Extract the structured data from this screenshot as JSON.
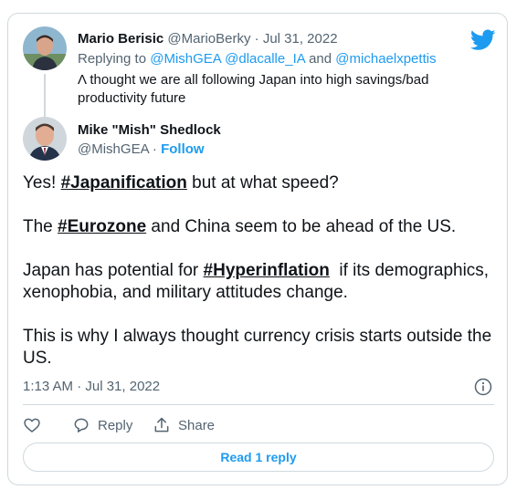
{
  "parent_tweet": {
    "name": "Mario Berisic",
    "handle": "@MarioBerky",
    "separator": "·",
    "date": "Jul 31, 2022",
    "replying_prefix": "Replying to",
    "mentions": [
      "@MishGEA",
      "@dlacalle_IA",
      "@michaelxpettis"
    ],
    "mention_joiner": "and",
    "text": "Λ thought we are all following Japan into high savings/bad productivity future"
  },
  "main_tweet": {
    "name": "Mike \"Mish\" Shedlock",
    "handle": "@MishGEA",
    "separator": "·",
    "follow_label": "Follow",
    "paragraphs": {
      "p1_before": "Yes! ",
      "p1_hashtag": "#Japanification",
      "p1_after": " but at what speed?",
      "p2_before": "The ",
      "p2_hashtag": "#Eurozone",
      "p2_after": " and China seem to be ahead of the US.",
      "p3_before": "Japan has potential for ",
      "p3_hashtag": "#Hyperinflation",
      "p3_after": "  if its demographics, xenophobia, and military attitudes change.",
      "p4": "This is why I always thought currency crisis starts outside the US."
    },
    "timestamp": "1:13 AM · Jul 31, 2022"
  },
  "actions": {
    "like_icon": "heart-icon",
    "reply_label": "Reply",
    "reply_icon": "speech-bubble-icon",
    "share_label": "Share",
    "share_icon": "share-arrow-icon",
    "info_icon": "info-icon"
  },
  "read_replies_label": "Read 1 reply",
  "colors": {
    "accent": "#1d9bf0",
    "text": "#0f1419",
    "secondary": "#536471",
    "border": "#cfd9de"
  }
}
